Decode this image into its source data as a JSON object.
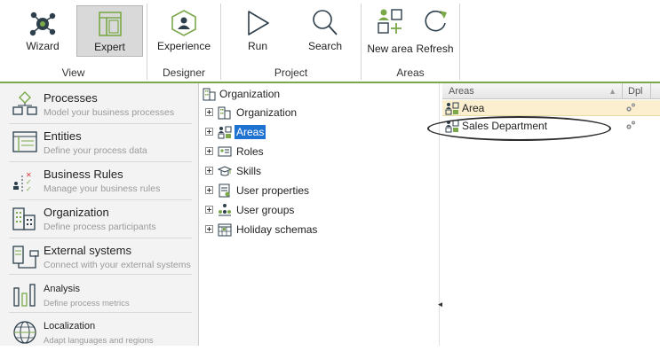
{
  "ribbon": {
    "groups": {
      "view": {
        "title": "View",
        "wizard_label": "Wizard",
        "expert_label": "Expert"
      },
      "designer": {
        "title": "Designer",
        "experience_label": "Experience"
      },
      "project": {
        "title": "Project",
        "run_label": "Run",
        "search_label": "Search"
      },
      "areas": {
        "title": "Areas",
        "new_area_label": "New area",
        "refresh_label": "Refresh"
      }
    },
    "accent_color": "#7aa84a",
    "active_button": "Expert"
  },
  "sidebar": {
    "items": [
      {
        "title": "Processes",
        "description": "Model your business processes",
        "icon": "processes-icon"
      },
      {
        "title": "Entities",
        "description": "Define your process data",
        "icon": "entities-icon"
      },
      {
        "title": "Business Rules",
        "description": "Manage your business rules",
        "icon": "business-rules-icon"
      },
      {
        "title": "Organization",
        "description": "Define process participants",
        "icon": "organization-icon"
      },
      {
        "title": "External systems",
        "description": "Connect with your external systems",
        "icon": "external-systems-icon"
      },
      {
        "title": "Analysis",
        "description": "Define process metrics",
        "icon": "analysis-icon"
      },
      {
        "title": "Localization",
        "description": "Adapt languages and regions",
        "icon": "localization-icon"
      }
    ]
  },
  "tree": {
    "root": "Organization",
    "nodes": [
      {
        "label": "Organization",
        "icon": "organization-icon"
      },
      {
        "label": "Areas",
        "icon": "areas-icon",
        "selected": true
      },
      {
        "label": "Roles",
        "icon": "roles-icon"
      },
      {
        "label": "Skills",
        "icon": "skills-icon"
      },
      {
        "label": "User properties",
        "icon": "user-properties-icon"
      },
      {
        "label": "User groups",
        "icon": "user-groups-icon"
      },
      {
        "label": "Holiday schemas",
        "icon": "holiday-schemas-icon"
      }
    ],
    "selection_color": "#1e73d2"
  },
  "grid": {
    "columns": [
      "Areas",
      "Dpl"
    ],
    "rows": [
      {
        "name": "Area",
        "selected": true
      },
      {
        "name": "Sales Department",
        "selected": false
      }
    ]
  }
}
